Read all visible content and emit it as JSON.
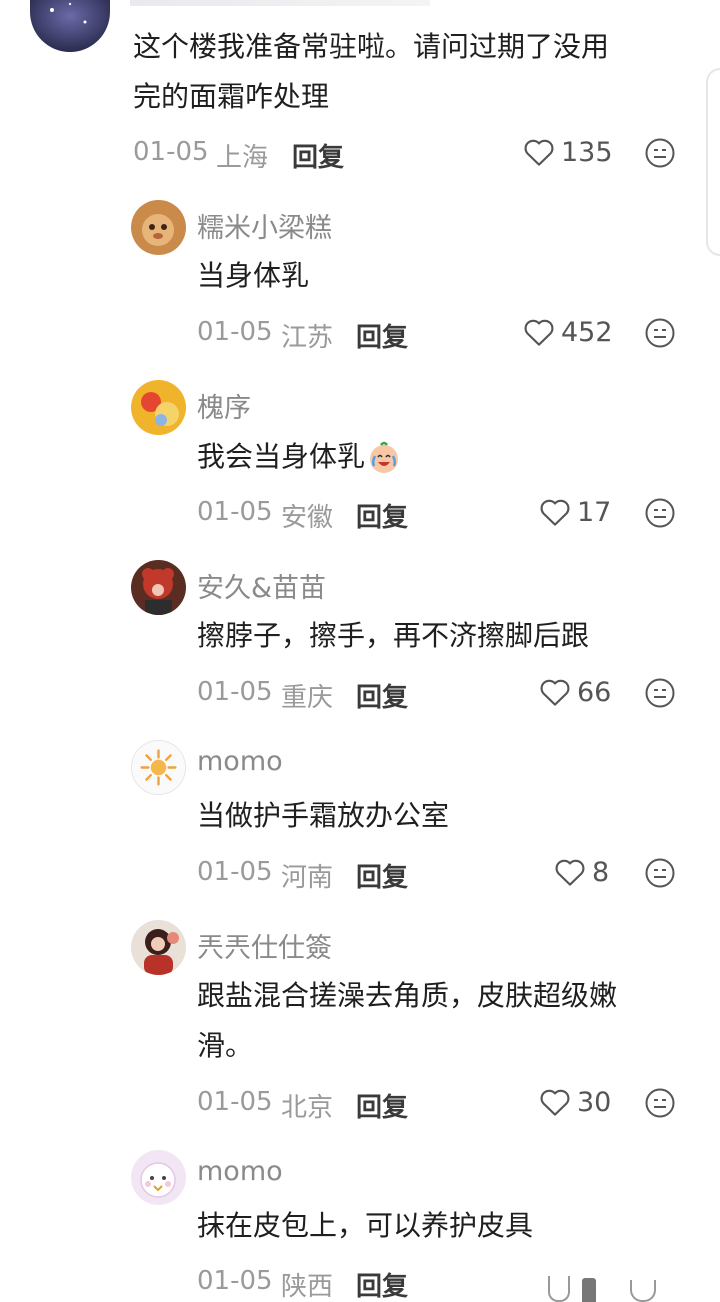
{
  "comments": [
    {
      "name": "",
      "text": "这个楼我准备常驻啦。请问过期了没用完的面霜咋处理",
      "text_lines": [
        "这个楼我准备常驻啦。请问过期了没用",
        "完的面霜咋处理"
      ],
      "date": "01-05",
      "location": "上海",
      "reply": "回复",
      "likes": "135"
    },
    {
      "name": "糯米小梁糕",
      "text": "当身体乳",
      "date": "01-05",
      "location": "江苏",
      "reply": "回复",
      "likes": "452"
    },
    {
      "name": "槐序",
      "text": "我会当身体乳",
      "date": "01-05",
      "location": "安徽",
      "reply": "回复",
      "likes": "17"
    },
    {
      "name": "安久&苗苗",
      "text": "擦脖子，擦手，再不济擦脚后跟",
      "date": "01-05",
      "location": "重庆",
      "reply": "回复",
      "likes": "66"
    },
    {
      "name": "momo",
      "text": "当做护手霜放办公室",
      "date": "01-05",
      "location": "河南",
      "reply": "回复",
      "likes": "8"
    },
    {
      "name": "兲兲仕仕簽",
      "text": "跟盐混合搓澡去角质，皮肤超级嫩滑。",
      "text_lines": [
        "跟盐混合搓澡去角质，皮肤超级嫩",
        "滑。"
      ],
      "date": "01-05",
      "location": "北京",
      "reply": "回复",
      "likes": "30"
    },
    {
      "name": "momo",
      "text": "抹在皮包上，可以养护皮具",
      "date": "01-05",
      "location": "陕西",
      "reply": "回复",
      "likes": ""
    }
  ],
  "icons": {
    "like": "heart-outline-icon",
    "dislike": "meh-face-icon",
    "emoji": "crying-laughing-emoji"
  }
}
